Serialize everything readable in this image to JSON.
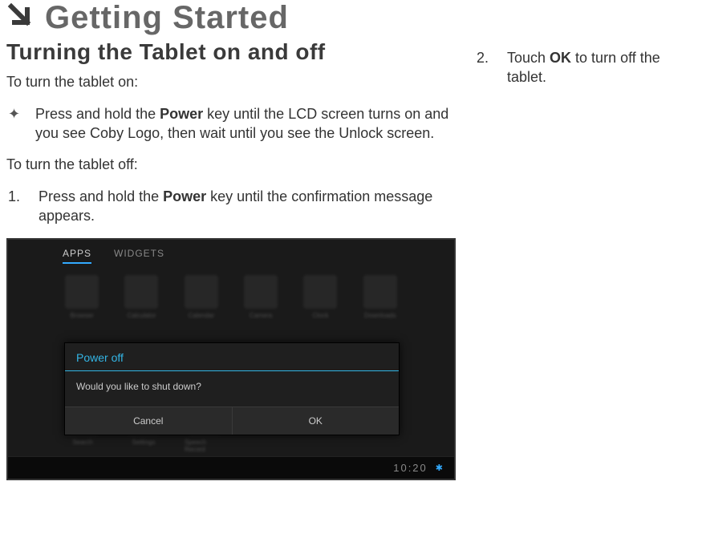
{
  "chapter": {
    "arrow": "↘",
    "title": "Getting Started"
  },
  "section": {
    "title": "Turning the Tablet on and off"
  },
  "turn_on_intro": "To turn the tablet on:",
  "turn_on_bullet": {
    "marker": "✦",
    "prefix": "Press and hold the ",
    "key": "Power",
    "suffix": " key until the LCD screen turns on and you see Coby Logo, then wait until you see the Unlock screen."
  },
  "turn_off_intro": "To turn the tablet off:",
  "step1": {
    "marker": "1.",
    "prefix": "Press and hold the ",
    "key": "Power",
    "suffix": " key until the confirmation message appears."
  },
  "step2": {
    "marker": "2.",
    "prefix": "Touch ",
    "key": "OK",
    "suffix": " to turn off the tablet."
  },
  "tablet": {
    "tabs": {
      "apps": "APPS",
      "widgets": "WIDGETS"
    },
    "icons_top": [
      "Browser",
      "Calculator",
      "Calendar",
      "Camera",
      "Clock",
      "Downloads"
    ],
    "icons_bottom": [
      "Search",
      "Settings",
      "Speech Record"
    ],
    "dialog": {
      "title": "Power off",
      "body": "Would you like to shut down?",
      "cancel": "Cancel",
      "ok": "OK"
    },
    "clock": "10:20"
  }
}
